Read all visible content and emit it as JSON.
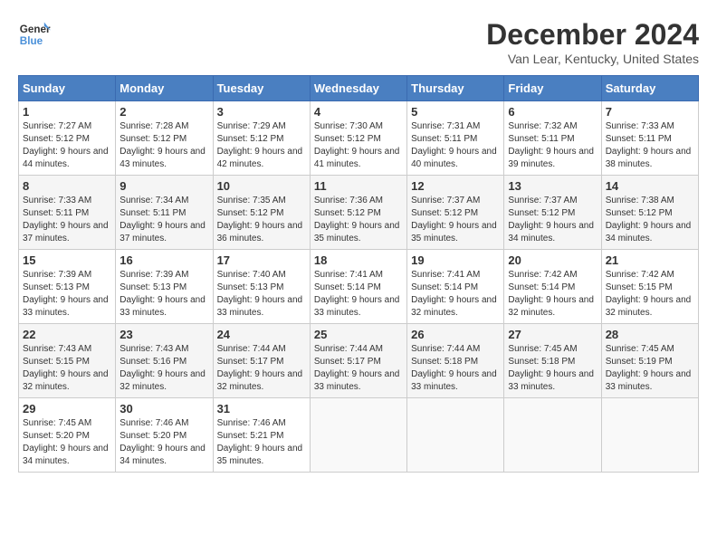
{
  "header": {
    "logo_line1": "General",
    "logo_line2": "Blue",
    "month_year": "December 2024",
    "location": "Van Lear, Kentucky, United States"
  },
  "weekdays": [
    "Sunday",
    "Monday",
    "Tuesday",
    "Wednesday",
    "Thursday",
    "Friday",
    "Saturday"
  ],
  "weeks": [
    [
      {
        "day": "1",
        "sunrise": "7:27 AM",
        "sunset": "5:12 PM",
        "daylight": "9 hours and 44 minutes."
      },
      {
        "day": "2",
        "sunrise": "7:28 AM",
        "sunset": "5:12 PM",
        "daylight": "9 hours and 43 minutes."
      },
      {
        "day": "3",
        "sunrise": "7:29 AM",
        "sunset": "5:12 PM",
        "daylight": "9 hours and 42 minutes."
      },
      {
        "day": "4",
        "sunrise": "7:30 AM",
        "sunset": "5:12 PM",
        "daylight": "9 hours and 41 minutes."
      },
      {
        "day": "5",
        "sunrise": "7:31 AM",
        "sunset": "5:11 PM",
        "daylight": "9 hours and 40 minutes."
      },
      {
        "day": "6",
        "sunrise": "7:32 AM",
        "sunset": "5:11 PM",
        "daylight": "9 hours and 39 minutes."
      },
      {
        "day": "7",
        "sunrise": "7:33 AM",
        "sunset": "5:11 PM",
        "daylight": "9 hours and 38 minutes."
      }
    ],
    [
      {
        "day": "8",
        "sunrise": "7:33 AM",
        "sunset": "5:11 PM",
        "daylight": "9 hours and 37 minutes."
      },
      {
        "day": "9",
        "sunrise": "7:34 AM",
        "sunset": "5:11 PM",
        "daylight": "9 hours and 37 minutes."
      },
      {
        "day": "10",
        "sunrise": "7:35 AM",
        "sunset": "5:12 PM",
        "daylight": "9 hours and 36 minutes."
      },
      {
        "day": "11",
        "sunrise": "7:36 AM",
        "sunset": "5:12 PM",
        "daylight": "9 hours and 35 minutes."
      },
      {
        "day": "12",
        "sunrise": "7:37 AM",
        "sunset": "5:12 PM",
        "daylight": "9 hours and 35 minutes."
      },
      {
        "day": "13",
        "sunrise": "7:37 AM",
        "sunset": "5:12 PM",
        "daylight": "9 hours and 34 minutes."
      },
      {
        "day": "14",
        "sunrise": "7:38 AM",
        "sunset": "5:12 PM",
        "daylight": "9 hours and 34 minutes."
      }
    ],
    [
      {
        "day": "15",
        "sunrise": "7:39 AM",
        "sunset": "5:13 PM",
        "daylight": "9 hours and 33 minutes."
      },
      {
        "day": "16",
        "sunrise": "7:39 AM",
        "sunset": "5:13 PM",
        "daylight": "9 hours and 33 minutes."
      },
      {
        "day": "17",
        "sunrise": "7:40 AM",
        "sunset": "5:13 PM",
        "daylight": "9 hours and 33 minutes."
      },
      {
        "day": "18",
        "sunrise": "7:41 AM",
        "sunset": "5:14 PM",
        "daylight": "9 hours and 33 minutes."
      },
      {
        "day": "19",
        "sunrise": "7:41 AM",
        "sunset": "5:14 PM",
        "daylight": "9 hours and 32 minutes."
      },
      {
        "day": "20",
        "sunrise": "7:42 AM",
        "sunset": "5:14 PM",
        "daylight": "9 hours and 32 minutes."
      },
      {
        "day": "21",
        "sunrise": "7:42 AM",
        "sunset": "5:15 PM",
        "daylight": "9 hours and 32 minutes."
      }
    ],
    [
      {
        "day": "22",
        "sunrise": "7:43 AM",
        "sunset": "5:15 PM",
        "daylight": "9 hours and 32 minutes."
      },
      {
        "day": "23",
        "sunrise": "7:43 AM",
        "sunset": "5:16 PM",
        "daylight": "9 hours and 32 minutes."
      },
      {
        "day": "24",
        "sunrise": "7:44 AM",
        "sunset": "5:17 PM",
        "daylight": "9 hours and 32 minutes."
      },
      {
        "day": "25",
        "sunrise": "7:44 AM",
        "sunset": "5:17 PM",
        "daylight": "9 hours and 33 minutes."
      },
      {
        "day": "26",
        "sunrise": "7:44 AM",
        "sunset": "5:18 PM",
        "daylight": "9 hours and 33 minutes."
      },
      {
        "day": "27",
        "sunrise": "7:45 AM",
        "sunset": "5:18 PM",
        "daylight": "9 hours and 33 minutes."
      },
      {
        "day": "28",
        "sunrise": "7:45 AM",
        "sunset": "5:19 PM",
        "daylight": "9 hours and 33 minutes."
      }
    ],
    [
      {
        "day": "29",
        "sunrise": "7:45 AM",
        "sunset": "5:20 PM",
        "daylight": "9 hours and 34 minutes."
      },
      {
        "day": "30",
        "sunrise": "7:46 AM",
        "sunset": "5:20 PM",
        "daylight": "9 hours and 34 minutes."
      },
      {
        "day": "31",
        "sunrise": "7:46 AM",
        "sunset": "5:21 PM",
        "daylight": "9 hours and 35 minutes."
      },
      null,
      null,
      null,
      null
    ]
  ]
}
